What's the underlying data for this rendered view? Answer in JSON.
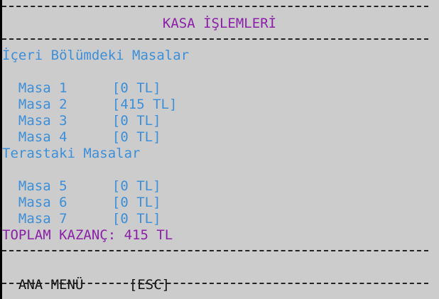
{
  "header": {
    "title": "KASA İŞLEMLERİ"
  },
  "sections": [
    {
      "title": "İçeri Bölümdeki Masalar",
      "tables": [
        {
          "name": "Masa 1",
          "amount": "[0 TL]"
        },
        {
          "name": "Masa 2",
          "amount": "[415 TL]"
        },
        {
          "name": "Masa 3",
          "amount": "[0 TL]"
        },
        {
          "name": "Masa 4",
          "amount": "[0 TL]"
        }
      ]
    },
    {
      "title": "Terastaki Masalar",
      "tables": [
        {
          "name": "Masa 5",
          "amount": "[0 TL]"
        },
        {
          "name": "Masa 6",
          "amount": "[0 TL]"
        },
        {
          "name": "Masa 7",
          "amount": "[0 TL]"
        }
      ]
    }
  ],
  "summary": {
    "total_text": "TOPLAM KAZANÇ: 415 TL"
  },
  "footer": {
    "menu_label": "ANA MENÜ",
    "key_hint": "[ESC]"
  },
  "colors": {
    "background": "#cccccc",
    "heading": "#8b1fa9",
    "table_text": "#3c8fd8",
    "footer_text": "#111111"
  }
}
